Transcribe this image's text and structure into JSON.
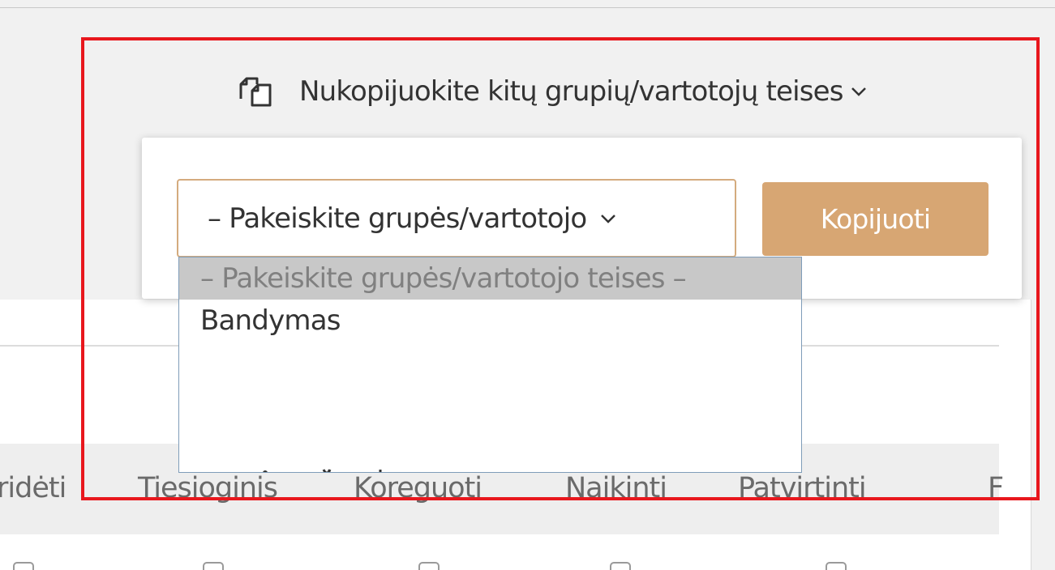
{
  "copy_rights": {
    "toggle_label": "Nukopijuokite kitų grupių/vartotojų teises",
    "select_value": "– Pakeiskite grupės/vartotojo",
    "copy_button": "Kopijuoti",
    "options": [
      "– Pakeiskite grupės/vartotojo teises –",
      "Bandymas"
    ],
    "icon": "copy-icon",
    "accent_color": "#d7a673"
  },
  "table": {
    "columns": [
      "ridėti",
      "Tiesioginis",
      "Koreguoti",
      "Naikinti",
      "Patvirtinti",
      "F"
    ]
  },
  "annotation": {
    "color": "#e8171d"
  }
}
